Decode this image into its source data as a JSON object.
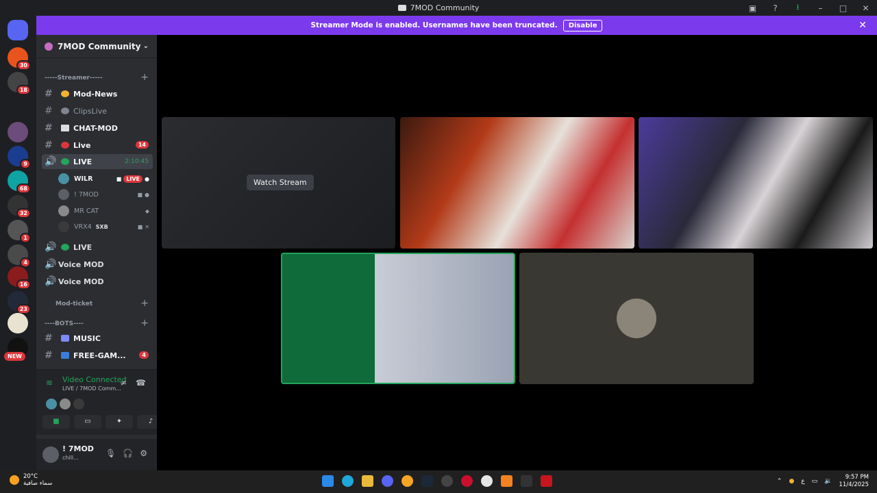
{
  "window": {
    "title": "7MOD Community"
  },
  "banner": {
    "text": "Streamer Mode is enabled. Usernames have been truncated.",
    "button": "Disable"
  },
  "guilds": {
    "badges": [
      "30",
      "18",
      "9",
      "68",
      "32",
      "1",
      "4",
      "16",
      "23"
    ],
    "new_label": "NEW"
  },
  "server": {
    "name": "7MOD Community"
  },
  "categories": {
    "streamer": "-----Streamer-----",
    "mod_ticket": "Mod-ticket",
    "bots": "----BOTS----"
  },
  "channels": [
    {
      "name": "Mod-News",
      "right": ""
    },
    {
      "name": "ClipsLive",
      "right": ""
    },
    {
      "name": "CHAT-MOD",
      "right": ""
    },
    {
      "name": "Live",
      "right": "14"
    },
    {
      "name": "LIVE",
      "right": "2:10:45"
    },
    {
      "name": "LIVE",
      "right": ""
    },
    {
      "name": "Voice MOD",
      "right": ""
    },
    {
      "name": "Voice MOD",
      "right": ""
    },
    {
      "name": "MUSIC",
      "right": ""
    },
    {
      "name": "FREE-GAM...",
      "right": "4"
    }
  ],
  "members": [
    {
      "name": "WILR",
      "tag": "LIVE"
    },
    {
      "name": "! 7MOD",
      "tag": ""
    },
    {
      "name": "MR CAT",
      "tag": ""
    },
    {
      "name": "VRX4",
      "tag": "SXB"
    }
  ],
  "voice": {
    "status": "Video Connected",
    "channel": "LIVE / 7MOD Comm..."
  },
  "user": {
    "name": "! 7MOD",
    "status": "chill..."
  },
  "stage": {
    "watch_label": "Watch Stream"
  },
  "taskbar": {
    "temp": "20°C",
    "weather": "سماء صافية",
    "lang": "ع",
    "time": "9:57 PM",
    "date": "11/4/2025"
  },
  "colors": {
    "accent": "#7c3aed",
    "connected": "#23a55a",
    "live": "#da373c"
  }
}
